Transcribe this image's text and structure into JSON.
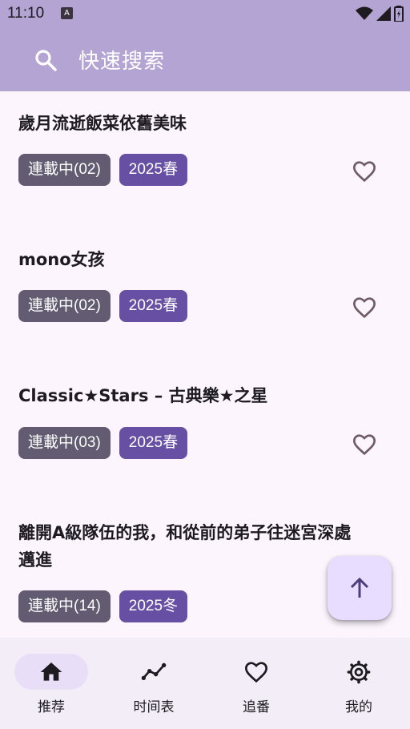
{
  "status_bar": {
    "time": "11:10",
    "notification_icon": "a-icon",
    "icons": [
      "wifi-icon",
      "signal-icon",
      "battery-icon"
    ]
  },
  "top_bar": {
    "search_icon": "search-icon",
    "search_label": "快速搜索"
  },
  "items": [
    {
      "title": "歲月流逝飯菜依舊美味",
      "status": "連載中(02)",
      "season": "2025春",
      "favorite_icon": "heart-outline-icon"
    },
    {
      "title": "mono女孩",
      "status": "連載中(02)",
      "season": "2025春",
      "favorite_icon": "heart-outline-icon"
    },
    {
      "title": "Classic★Stars – 古典樂★之星",
      "status": "連載中(03)",
      "season": "2025春",
      "favorite_icon": "heart-outline-icon"
    },
    {
      "title": "離開A級隊伍的我，和從前的弟子往迷宮深處邁進",
      "status": "連載中(14)",
      "season": "2025冬",
      "favorite_icon": "heart-outline-icon"
    }
  ],
  "fab": {
    "icon": "arrow-up-icon"
  },
  "nav": [
    {
      "label": "推荐",
      "icon": "home-icon",
      "active": true
    },
    {
      "label": "时间表",
      "icon": "timeline-icon",
      "active": false
    },
    {
      "label": "追番",
      "icon": "heart-icon",
      "active": false
    },
    {
      "label": "我的",
      "icon": "settings-icon",
      "active": false
    }
  ],
  "colors": {
    "header": "#b3a4d4",
    "background": "#fcf5fd",
    "status_chip": "#625b71",
    "season_chip": "#6750a4",
    "fab": "#e9ddff",
    "nav_background": "#f3edf7",
    "nav_active_pill": "#e8def8"
  }
}
